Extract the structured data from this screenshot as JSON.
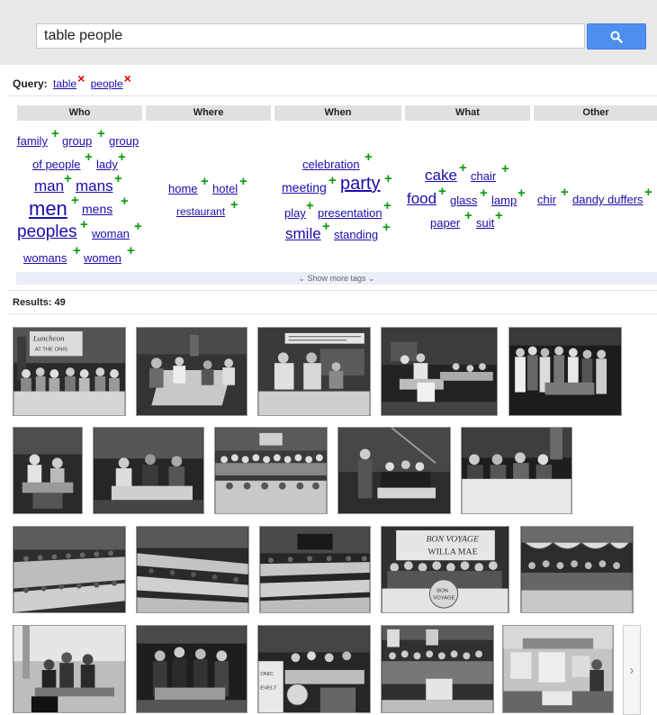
{
  "search": {
    "value": "table people"
  },
  "query": {
    "label": "Query:",
    "tags": [
      "table",
      "people"
    ]
  },
  "facets": {
    "headers": [
      "Who",
      "Where",
      "When",
      "What",
      "Other"
    ],
    "show_more": "Show more tags",
    "who": [
      "family",
      "group",
      "group",
      "of people",
      "lady",
      "man",
      "mans",
      "men",
      "mens",
      "peoples",
      "woman",
      "womans",
      "women"
    ],
    "where": [
      "home",
      "hotel",
      "restaurant"
    ],
    "when": [
      "celebration",
      "meeting",
      "party",
      "play",
      "presentation",
      "smile",
      "standing"
    ],
    "what": [
      "cake",
      "chair",
      "food",
      "glass",
      "lamp",
      "paper",
      "suit"
    ],
    "other": [
      "chir",
      "dandy duffers"
    ]
  },
  "results": {
    "label": "Results: 49",
    "sign_texts": [
      "Luncheon",
      "AT THE ONIS",
      "BON VOYAGE",
      "WILLA MAE",
      "BON",
      "VOYAGE",
      "ONIC",
      "EVELT"
    ]
  },
  "icons": {
    "search": "search-icon",
    "remove": "remove-x-icon",
    "add": "add-plus-icon",
    "chevron": "chevron-down-icon",
    "next": "chevron-right-icon"
  },
  "colors": {
    "link": "#1a0dab",
    "plus": "#0a9a0a",
    "remove": "#e00000",
    "search_button": "#4d8ff0"
  }
}
